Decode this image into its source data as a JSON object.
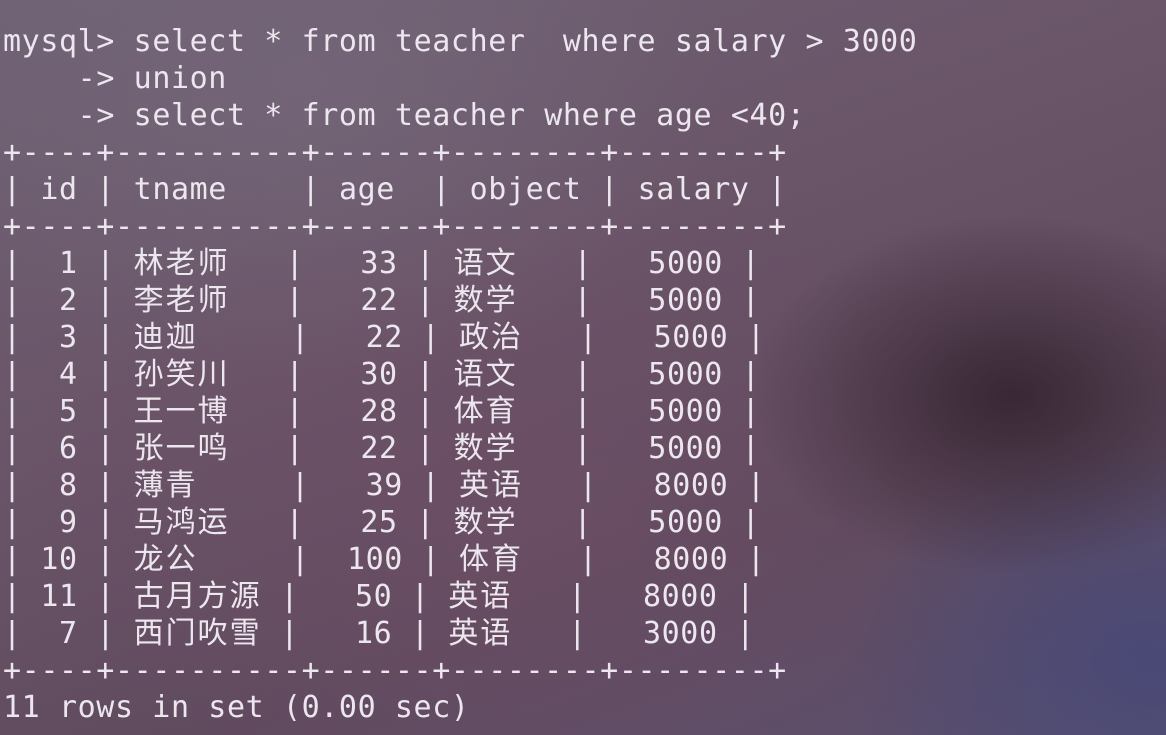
{
  "terminal": {
    "prompt": "mysql>",
    "continuation_prompt": "->",
    "query_lines": [
      "select * from teacher  where salary > 3000",
      "union",
      "select * from teacher where age <40;"
    ],
    "table": {
      "columns": [
        "id",
        "tname",
        "age",
        "object",
        "salary"
      ],
      "rows": [
        [
          "1",
          "林老师",
          "33",
          "语文",
          "5000"
        ],
        [
          "2",
          "李老师",
          "22",
          "数学",
          "5000"
        ],
        [
          "3",
          "迪迦",
          "22",
          "政治",
          "5000"
        ],
        [
          "4",
          "孙笑川",
          "30",
          "语文",
          "5000"
        ],
        [
          "5",
          "王一博",
          "28",
          "体育",
          "5000"
        ],
        [
          "6",
          "张一鸣",
          "22",
          "数学",
          "5000"
        ],
        [
          "8",
          "薄青",
          "39",
          "英语",
          "8000"
        ],
        [
          "9",
          "马鸿运",
          "25",
          "数学",
          "5000"
        ],
        [
          "10",
          "龙公",
          "100",
          "体育",
          "8000"
        ],
        [
          "11",
          "古月方源",
          "50",
          "英语",
          "8000"
        ],
        [
          "7",
          "西门吹雪",
          "16",
          "英语",
          "3000"
        ]
      ]
    },
    "result_summary": "11 rows in set (0.00 sec)"
  }
}
